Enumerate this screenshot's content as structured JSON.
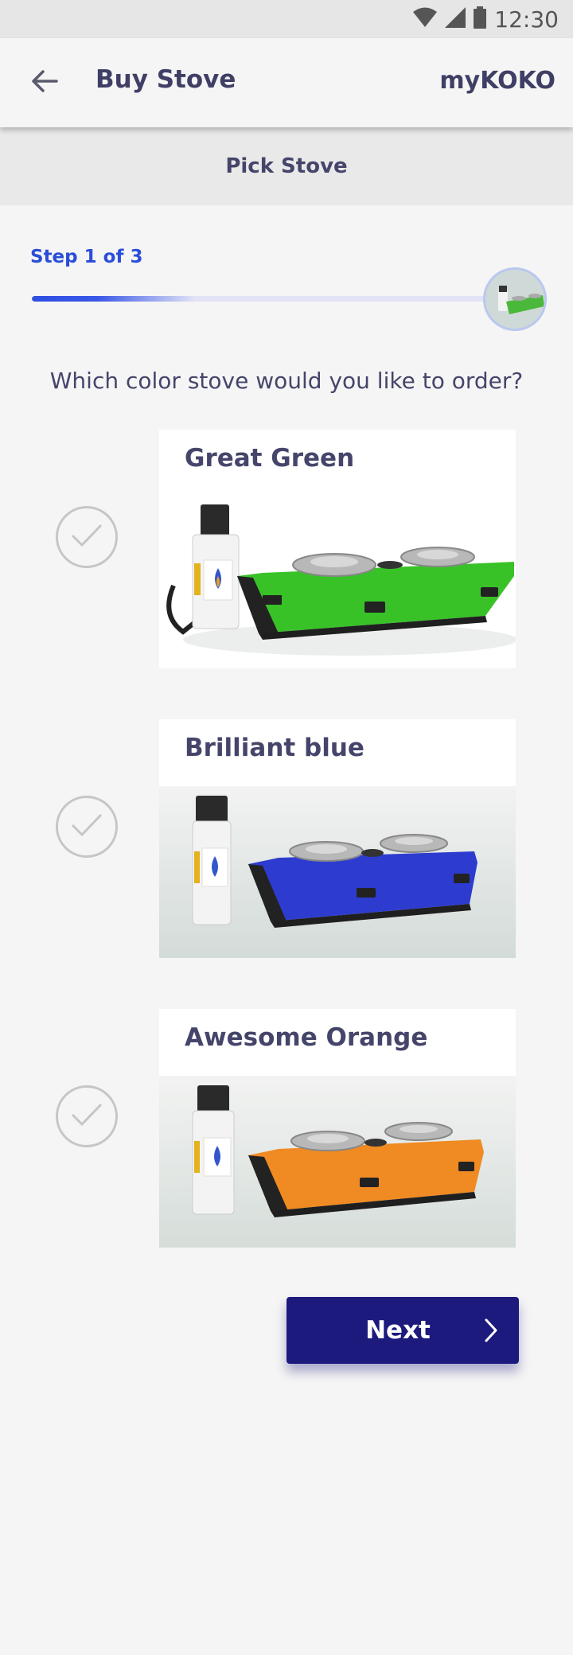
{
  "status_bar": {
    "time": "12:30"
  },
  "app_bar": {
    "title": "Buy Stove",
    "brand": "myKOKO"
  },
  "section": {
    "title": "Pick Stove"
  },
  "progress": {
    "step_label": "Step 1 of 3",
    "fraction": 0.33
  },
  "question": "Which color stove would you like to order?",
  "options": [
    {
      "label": "Great Green",
      "color": "#34c324",
      "bg": "#ffffff"
    },
    {
      "label": "Brilliant blue",
      "color": "#2a3fd6",
      "bg": "#dde2e0"
    },
    {
      "label": "Awesome Orange",
      "color": "#f08a22",
      "bg": "#dfe4e1"
    }
  ],
  "next_button": {
    "label": "Next"
  }
}
